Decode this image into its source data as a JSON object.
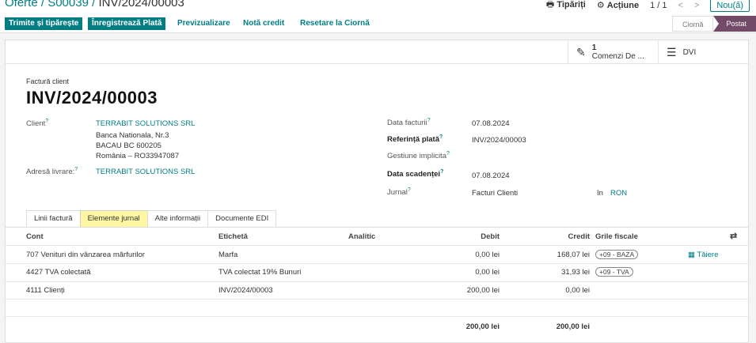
{
  "breadcrumb": {
    "items": [
      "Oferte",
      "S00039"
    ],
    "current": "INV/2024/00003",
    "separator": "/"
  },
  "header": {
    "print_label": "Tipăriți",
    "action_label": "Acțiune",
    "pager": "1 / 1",
    "new_label": "Nou(ă)"
  },
  "actions": {
    "send_print": "Trimite și tipărește",
    "register_payment": "Înregistrează Plată",
    "preview": "Previzualizare",
    "credit_note": "Notă credit",
    "reset_draft": "Resetare la Ciornă"
  },
  "statusbar": {
    "draft": "Ciornă",
    "posted": "Postat"
  },
  "smart_buttons": [
    {
      "count": "1",
      "label": "Comenzi De ..."
    },
    {
      "count": "",
      "label": "DVI"
    }
  ],
  "doc": {
    "type_label": "Factură client",
    "number": "INV/2024/00003"
  },
  "fields": {
    "client_label": "Client",
    "client_name": "TERRABIT SOLUTIONS SRL",
    "client_addr1": "Banca Nationala, Nr.3",
    "client_addr2": "BACAU BC 600205",
    "client_addr3": "România – RO33947087",
    "delivery_label": "Adresă livrare:",
    "delivery_value": "TERRABIT SOLUTIONS SRL",
    "invoice_date_label": "Data facturii",
    "invoice_date": "07.08.2024",
    "payment_ref_label": "Referință plată",
    "payment_ref": "INV/2024/00003",
    "default_mgmt_label": "Gestiune implicita",
    "due_date_label": "Data scadenței",
    "due_date": "07.08.2024",
    "journal_label": "Jurnal",
    "journal": "Facturi Clienti",
    "in_label": "în",
    "currency": "RON",
    "help_mark": "?"
  },
  "tabs": [
    "Linii factură",
    "Elemente jurnal",
    "Alte informații",
    "Documente EDI"
  ],
  "table": {
    "columns": {
      "account": "Cont",
      "label": "Etichetă",
      "analytic": "Analitic",
      "debit": "Debit",
      "credit": "Credit",
      "tax_grids": "Grile fiscale"
    },
    "rows": [
      {
        "account": "707 Venituri din vânzarea mărfurilor",
        "label": "Marfa",
        "debit": "0,00 lei",
        "credit": "168,07 lei",
        "tag": "+09 - BAZA",
        "action": "Tăiere"
      },
      {
        "account": "4427 TVA colectată",
        "label": "TVA colectat 19% Bunuri",
        "debit": "0,00 lei",
        "credit": "31,93 lei",
        "tag": "+09 - TVA",
        "action": ""
      },
      {
        "account": "4111 Clienți",
        "label": "INV/2024/00003",
        "debit": "200,00 lei",
        "credit": "0,00 lei",
        "tag": "",
        "action": ""
      }
    ],
    "totals": {
      "debit": "200,00 lei",
      "credit": "200,00 lei"
    }
  }
}
